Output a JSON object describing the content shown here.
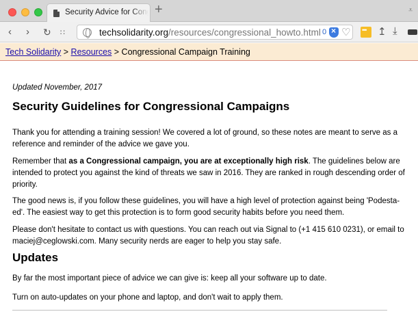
{
  "browser": {
    "tab_title": "Security Advice for Congressional Campaigns",
    "new_tab_symbol": "+",
    "url_host": "techsolidarity.org",
    "url_path": "/resources/congressional_howto.html",
    "blocker_count": "0",
    "icons": [
      "back-icon",
      "forward-icon",
      "reload-icon",
      "grid-icon",
      "globe-icon",
      "shield-icon",
      "heart-icon",
      "extension-icon",
      "share-icon",
      "download-icon",
      "battery-icon"
    ]
  },
  "breadcrumb": {
    "home": "Tech Solidarity",
    "sep1": " > ",
    "resources": "Resources",
    "sep2": " > ",
    "current": "Congressional Campaign Training"
  },
  "article": {
    "updated": "Updated November, 2017",
    "title": "Security Guidelines for Congressional Campaigns",
    "p1": "Thank you for attending a training session! We covered a lot of ground, so these notes are meant to serve as a reference and reminder of the advice we gave you.",
    "p2_pre": "Remember that ",
    "p2_bold": "as a Congressional campaign, you are at exceptionally high risk",
    "p2_post": ". The guidelines below are intended to protect you against the kind of threats we saw in 2016. They are ranked in rough descending order of priority.",
    "p3": "The good news is, if you follow these guidelines, you will have a high level of protection against being 'Podesta-ed'. The easiest way to get this protection is to form good security habits before you need them.",
    "p4": "Please don't hesitate to contact us with questions. You can reach out via Signal to (+1 415 610 0231), or email to maciej@ceglowski.com. Many security nerds are eager to help you stay safe.",
    "updates_heading": "Updates",
    "p5": "By far the most important piece of advice we can give is: keep all your software up to date.",
    "p6": "Turn on auto-updates on your phone and laptop, and don't wait to apply them."
  }
}
